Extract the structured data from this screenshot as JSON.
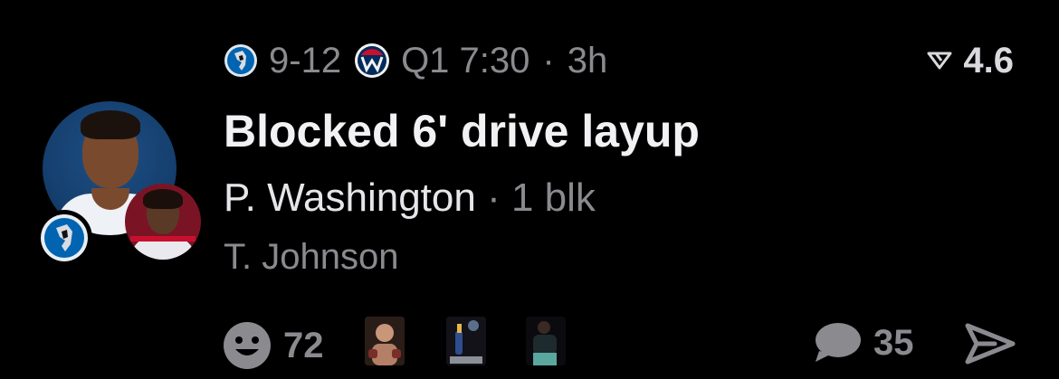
{
  "game": {
    "home_team_icon": "mavericks-logo-icon",
    "score": "9-12",
    "away_team_icon": "wizards-logo-icon",
    "period_clock": "Q1 7:30",
    "separator": "·",
    "age": "3h"
  },
  "rating": {
    "icon": "rating-triangle-icon",
    "value": "4.6"
  },
  "play": {
    "headline": "Blocked 6' drive layup",
    "player": "P. Washington",
    "separator": "·",
    "stat": "1 blk",
    "secondary_player": "T. Johnson"
  },
  "engagement": {
    "reaction_icon": "smiley-icon",
    "reaction_count": "72",
    "comment_icon": "chat-bubble-icon",
    "comment_count": "35",
    "share_icon": "send-arrow-icon"
  },
  "colors": {
    "background": "#000000",
    "primary_text": "#f2f2f5",
    "secondary_text": "#8a8a8f",
    "mavericks_blue": "#0064b1",
    "wizards_red": "#c8102e",
    "wizards_blue": "#002b5c"
  }
}
